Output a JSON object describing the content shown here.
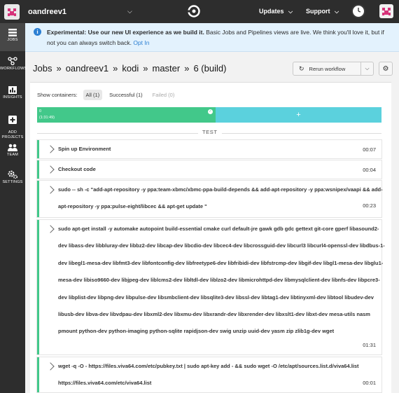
{
  "topbar": {
    "org_name": "oandreev1",
    "updates_label": "Updates",
    "support_label": "Support"
  },
  "sidebar": {
    "items": [
      {
        "label": "JOBS",
        "icon": "list-icon"
      },
      {
        "label": "WORKFLOWS",
        "icon": "workflow-icon"
      },
      {
        "label": "INSIGHTS",
        "icon": "bar-chart-icon"
      },
      {
        "label": "ADD\nPROJECTS",
        "icon": "plus-square-icon"
      },
      {
        "label": "TEAM",
        "icon": "people-icon"
      },
      {
        "label": "SETTINGS",
        "icon": "gears-icon"
      }
    ]
  },
  "banner": {
    "bold_text": "Experimental: Use our new UI experience as we build it.",
    "text": " Basic Jobs and Pipelines views are live. We think you'll love it, but if not you can always switch back. ",
    "link": "Opt In"
  },
  "breadcrumb": [
    "Jobs",
    "»",
    "oandreev1",
    "»",
    "kodi",
    "»",
    "master",
    "»",
    "6 (build)"
  ],
  "actions": {
    "rerun_label": "Rerun workflow"
  },
  "containers": {
    "label": "Show containers:",
    "filters": [
      {
        "label": "All (1)",
        "state": "active"
      },
      {
        "label": "Successful (1)",
        "state": "normal"
      },
      {
        "label": "Failed (0)",
        "state": "disabled"
      }
    ],
    "bar_index": "0",
    "bar_duration": "(1:31:49)",
    "add_label": "+"
  },
  "section_label": "TEST",
  "steps": [
    {
      "command": "Spin up Environment",
      "time": "00:07"
    },
    {
      "command": "Checkout code",
      "time": "00:04"
    },
    {
      "command": "sudo -- sh -c \"add-apt-repository -y ppa:team-xbmc/xbmc-ppa-build-depends && add-apt-repository -y ppa:wsnipex/vaapi && add-apt-repository -y ppa:pulse-eight/libcec && apt-get update \"",
      "time": "00:23"
    },
    {
      "command": "sudo apt-get install -y automake autopoint build-essential cmake curl default-jre gawk gdb gdc gettext git-core gperf libasound2-dev libass-dev libbluray-dev libbz2-dev libcap-dev libcdio-dev libcec4-dev libcrossguid-dev libcurl3 libcurl4-openssl-dev libdbus-1-dev libegl1-mesa-dev libfmt3-dev libfontconfig-dev libfreetype6-dev libfribidi-dev libfstrcmp-dev libgif-dev libgl1-mesa-dev libglu1-mesa-dev libiso9660-dev libjpeg-dev liblcms2-dev libltdl-dev liblzo2-dev libmicrohttpd-dev libmysqlclient-dev libnfs-dev libpcre3-dev libplist-dev libpng-dev libpulse-dev libsmbclient-dev libsqlite3-dev libssl-dev libtag1-dev libtinyxml-dev libtool libudev-dev libusb-dev libva-dev libvdpau-dev libxml2-dev libxmu-dev libxrandr-dev libxrender-dev libxslt1-dev libxt-dev mesa-utils nasm pmount python-dev python-imaging python-sqlite rapidjson-dev swig unzip uuid-dev yasm zip zlib1g-dev wget",
      "time": "01:31"
    },
    {
      "command": "wget -q -O - https://files.viva64.com/etc/pubkey.txt | sudo apt-key add - && sudo wget -O /etc/apt/sources.list.d/viva64.list https://files.viva64.com/etc/viva64.list",
      "time": "00:01"
    }
  ]
}
